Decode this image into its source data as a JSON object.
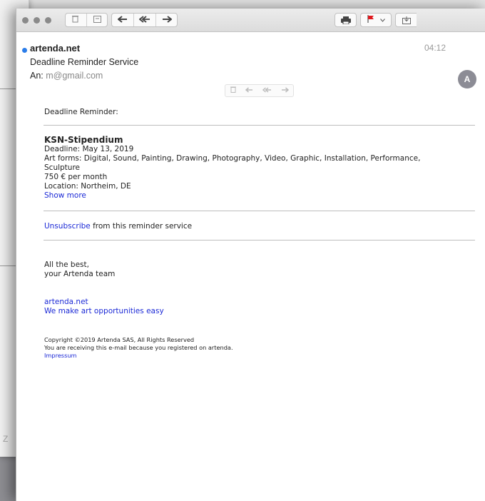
{
  "background": {
    "stray_char": "Z"
  },
  "toolbar": {
    "icons": [
      "trash-icon",
      "archive-icon",
      "reply-icon",
      "reply-all-icon",
      "forward-icon",
      "print-icon",
      "flag-icon",
      "move-icon"
    ],
    "reply": "←",
    "reply_all": "«",
    "forward": "→"
  },
  "email": {
    "sender": "artenda.net",
    "subject": "Deadline Reminder Service",
    "to_label": "An:",
    "to_address": "m@gmail.com",
    "time": "04:12",
    "avatar_initial": "A"
  },
  "content": {
    "intro": "Deadline Reminder:",
    "listing": {
      "title": "KSN-Stipendium",
      "deadline": "Deadline: May 13, 2019",
      "art_forms_line1": "Art forms: Digital, Sound, Painting, Drawing, Photography, Video, Graphic, Installation, Performance,",
      "art_forms_line2": "Sculpture",
      "amount": "750 € per month",
      "location": "Location: Northeim, DE",
      "show_more": "Show more"
    },
    "unsubscribe_link": "Unsubscribe",
    "unsubscribe_text": " from this reminder service",
    "signoff_line1": "All the best,",
    "signoff_line2": "your Artenda team",
    "site_link": "artenda.net",
    "tagline_link": "We make art opportunities easy",
    "copyright": "Copyright ©2019 Artenda SAS, All Rights Reserved",
    "notice": "You are receiving this e-mail because you registered on artenda.",
    "impressum": "Impressum"
  },
  "colors": {
    "link": "#1a28d6",
    "unread_dot": "#2b7de9",
    "flag": "#e0191e"
  }
}
